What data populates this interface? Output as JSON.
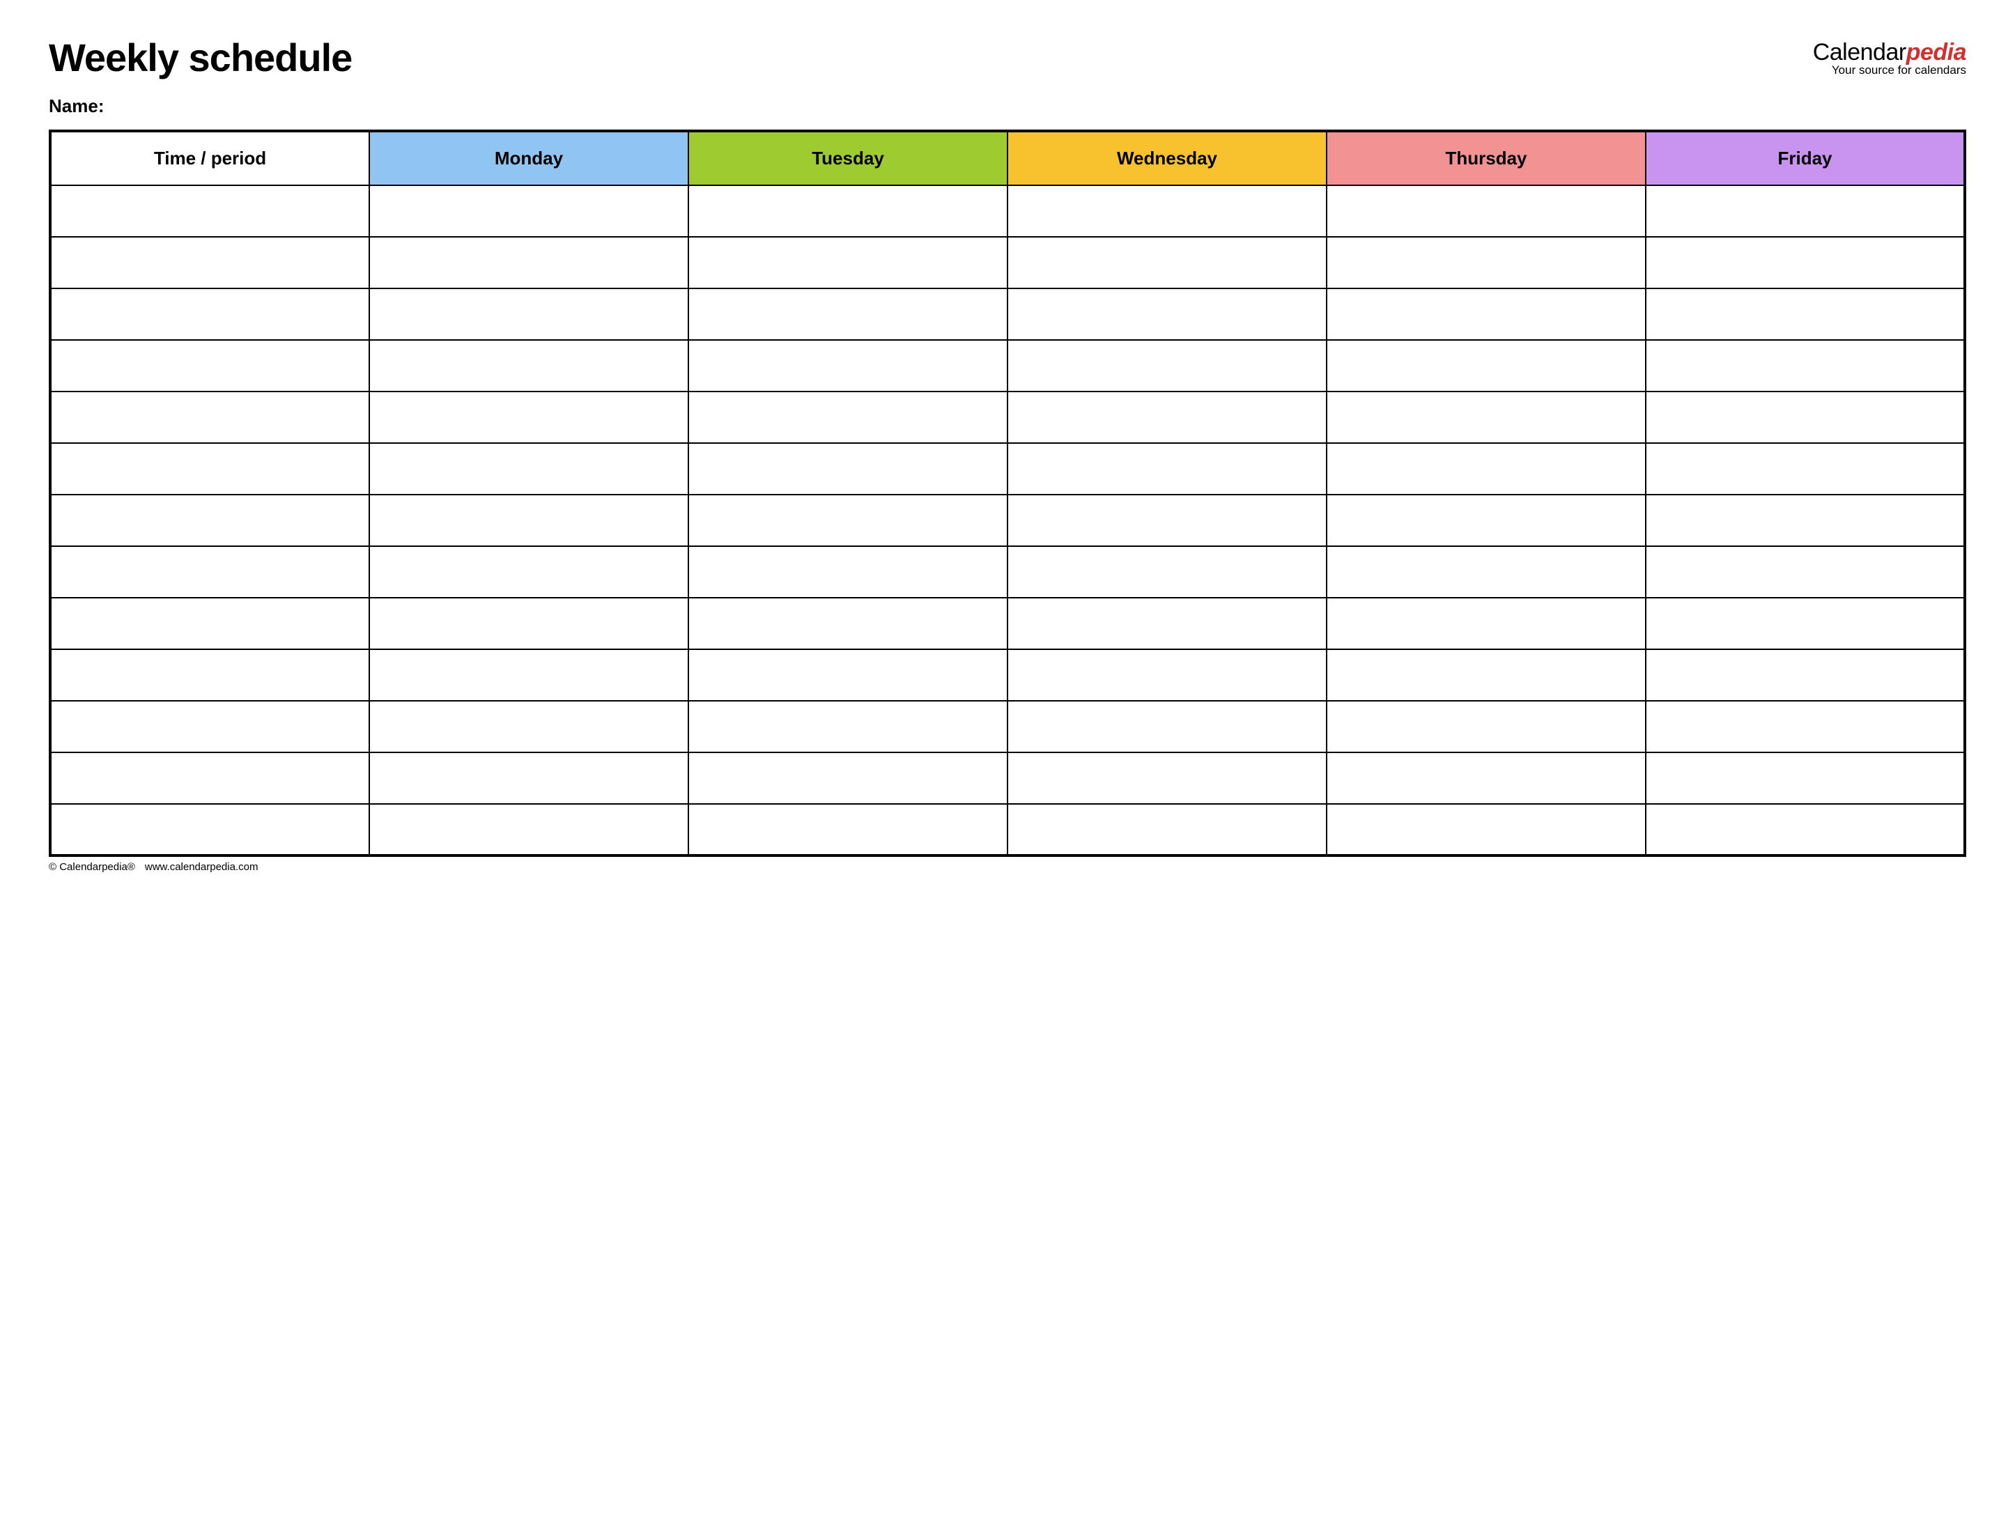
{
  "header": {
    "title": "Weekly schedule",
    "name_label": "Name:"
  },
  "brand": {
    "name_prefix": "Calendar",
    "name_accent": "pedia",
    "tagline": "Your source for calendars"
  },
  "columns": {
    "time": "Time / period",
    "days": [
      "Monday",
      "Tuesday",
      "Wednesday",
      "Thursday",
      "Friday"
    ]
  },
  "colors": {
    "monday": "#8fc5f0",
    "tuesday": "#9ecb2f",
    "wednesday": "#f7c22e",
    "thursday": "#f29292",
    "friday": "#c993f0"
  },
  "row_count": 13,
  "footer": {
    "copyright": "© Calendarpedia®",
    "site": "www.calendarpedia.com"
  }
}
